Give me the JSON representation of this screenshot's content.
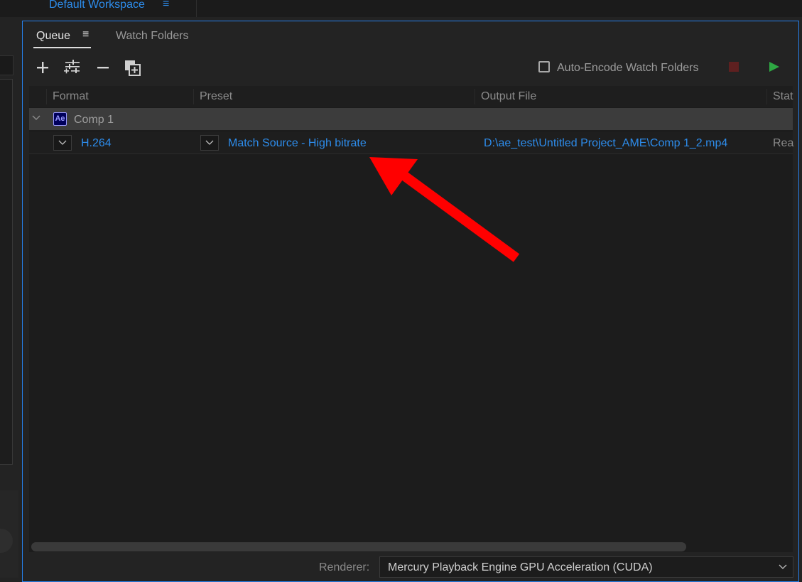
{
  "header": {
    "workspace_label": "Default Workspace",
    "workspace_menu_glyph": "≡"
  },
  "tabs": [
    {
      "label": "Queue",
      "menu_glyph": "≡",
      "active": true
    },
    {
      "label": "Watch Folders",
      "active": false
    }
  ],
  "toolbar": {
    "icons": [
      "add-source-icon",
      "settings-sliders-icon",
      "remove-icon",
      "duplicate-icon"
    ],
    "auto_encode_label": "Auto-Encode Watch Folders",
    "auto_encode_checked": false,
    "stop_color": "#5e2020",
    "start_color": "#2ea843"
  },
  "columns": [
    "Format",
    "Preset",
    "Output File",
    "Stat"
  ],
  "queue": {
    "group": {
      "app_badge": "Ae",
      "name": "Comp 1"
    },
    "items": [
      {
        "format": "H.264",
        "preset": "Match Source - High bitrate",
        "output_file": "D:\\ae_test\\Untitled Project_AME\\Comp 1_2.mp4",
        "status": "Rea"
      }
    ]
  },
  "renderer": {
    "label": "Renderer:",
    "value": "Mercury Playback Engine GPU Acceleration (CUDA)"
  },
  "annotation": {
    "color": "#ff0000"
  },
  "colors": {
    "accent": "#2d8ceb",
    "panel_border": "#2680eb",
    "background": "#232323"
  }
}
